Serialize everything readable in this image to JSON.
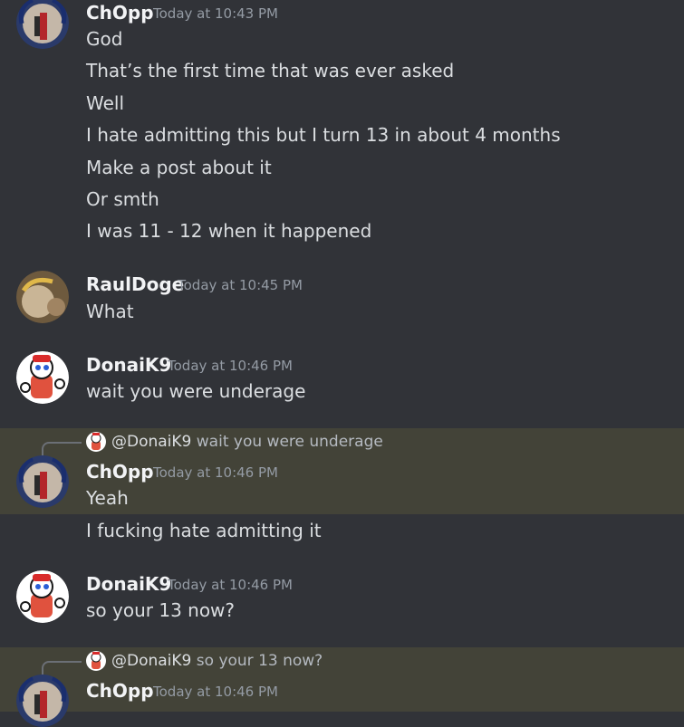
{
  "messages": [
    {
      "author": "ChOpp",
      "time": "Today at 10:43 PM",
      "lines": [
        "God",
        "That’s the first time that was ever asked",
        "Well",
        "I hate admitting this but I turn 13 in about 4 months",
        "Make a post about it",
        "Or smth",
        "I was 11 - 12 when it happened"
      ]
    },
    {
      "author": "RaulDoge",
      "time": "Today at 10:45 PM",
      "lines": [
        "What"
      ]
    },
    {
      "author": "DonaiK9",
      "time": "Today at 10:46 PM",
      "lines": [
        "wait you were underage"
      ]
    },
    {
      "author": "ChOpp",
      "time": "Today at 10:46 PM",
      "reply": {
        "mention": "@DonaiK9",
        "text": "wait you were underage"
      },
      "lines": [
        "Yeah",
        "I fucking hate admitting it"
      ]
    },
    {
      "author": "DonaiK9",
      "time": "Today at 10:46 PM",
      "lines": [
        "so your 13 now?"
      ]
    },
    {
      "author": "ChOpp",
      "time": "Today at 10:46 PM",
      "reply": {
        "mention": "@DonaiK9",
        "text": "so your 13 now?"
      },
      "lines": []
    }
  ],
  "colors": {
    "background": "#313338",
    "highlight": "#434338",
    "text": "#dbdee1",
    "muted": "#949ba4"
  }
}
